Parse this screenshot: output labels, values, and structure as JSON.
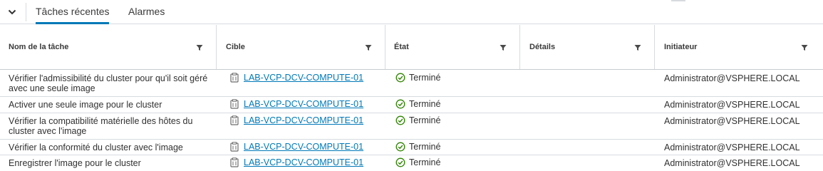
{
  "tabs": [
    {
      "label": "Tâches récentes",
      "active": true
    },
    {
      "label": "Alarmes",
      "active": false
    }
  ],
  "columns": [
    {
      "label": "Nom de la tâche"
    },
    {
      "label": "Cible"
    },
    {
      "label": "État"
    },
    {
      "label": "Détails"
    },
    {
      "label": "Initiateur"
    }
  ],
  "rows": [
    {
      "task": "Vérifier l'admissibilité du cluster pour qu'il soit géré avec une seule image",
      "target": "LAB-VCP-DCV-COMPUTE-01",
      "state": "Terminé",
      "details": "",
      "initiator": "Administrator@VSPHERE.LOCAL"
    },
    {
      "task": "Activer une seule image pour le cluster",
      "target": "LAB-VCP-DCV-COMPUTE-01",
      "state": "Terminé",
      "details": "",
      "initiator": "Administrator@VSPHERE.LOCAL"
    },
    {
      "task": "Vérifier la compatibilité matérielle des hôtes du cluster avec l'image",
      "target": "LAB-VCP-DCV-COMPUTE-01",
      "state": "Terminé",
      "details": "",
      "initiator": "Administrator@VSPHERE.LOCAL"
    },
    {
      "task": "Vérifier la conformité du cluster avec l'image",
      "target": "LAB-VCP-DCV-COMPUTE-01",
      "state": "Terminé",
      "details": "",
      "initiator": "Administrator@VSPHERE.LOCAL"
    },
    {
      "task": "Enregistrer l'image pour le cluster",
      "target": "LAB-VCP-DCV-COMPUTE-01",
      "state": "Terminé",
      "details": "",
      "initiator": "Administrator@VSPHERE.LOCAL"
    }
  ],
  "icons": {
    "collapse": "chevron-down-icon",
    "filter": "filter-icon",
    "target": "cluster-icon",
    "state": "check-circle-icon"
  },
  "colors": {
    "link": "#0079b8",
    "success": "#2f8400",
    "active_tab": "#0079b8"
  }
}
